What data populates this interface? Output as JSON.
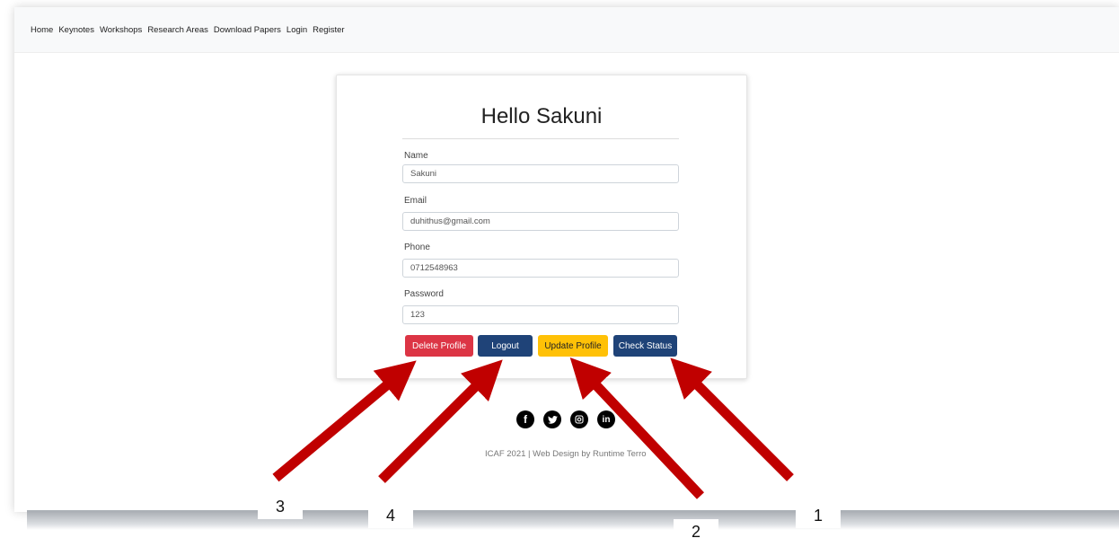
{
  "nav": {
    "links": [
      "Home",
      "Keynotes",
      "Workshops",
      "Research Areas",
      "Download Papers",
      "Login",
      "Register"
    ]
  },
  "profile": {
    "title": "Hello Sakuni",
    "fields": {
      "name": {
        "label": "Name",
        "value": "Sakuni"
      },
      "email": {
        "label": "Email",
        "value": "duhithus@gmail.com"
      },
      "phone": {
        "label": "Phone",
        "value": "0712548963"
      },
      "password": {
        "label": "Password",
        "value": "123"
      }
    },
    "buttons": {
      "delete": "Delete Profile",
      "logout": "Logout",
      "update": "Update Profile",
      "status": "Check Status"
    }
  },
  "footer": {
    "icons": [
      "facebook-icon",
      "twitter-icon",
      "instagram-icon",
      "linkedin-icon"
    ],
    "text": "ICAF 2021 | Web Design by Runtime Terro"
  },
  "annotations": {
    "markers": [
      "1",
      "2",
      "3",
      "4"
    ]
  },
  "colors": {
    "delete": "#dc3545",
    "logout": "#1f4378",
    "update": "#ffc107",
    "status": "#1f4378",
    "arrow": "#c00000"
  }
}
